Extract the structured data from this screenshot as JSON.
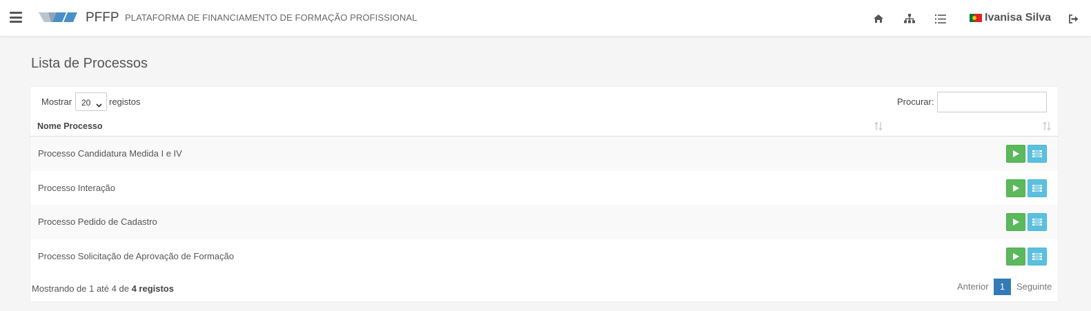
{
  "header": {
    "brand": "PFFP",
    "platform_name": "PLATAFORMA DE FINANCIAMENTO DE FORMAÇÃO PROFISSIONAL",
    "user_name": "Ivanisa Silva",
    "icons": [
      "menu-icon",
      "home-icon",
      "sitemap-icon",
      "list-icon",
      "portugal-flag-icon",
      "logout-icon"
    ],
    "logo_color": "#4a90c8"
  },
  "page": {
    "title": "Lista de Processos"
  },
  "table_controls": {
    "show_label": "Mostrar",
    "page_size": "20",
    "records_label": "registos",
    "search_label": "Procurar:",
    "search_value": ""
  },
  "table": {
    "column_name": "Nome Processo",
    "rows": [
      {
        "name": "Processo Candidatura Medida I e IV"
      },
      {
        "name": "Processo Interação"
      },
      {
        "name": "Processo Pedido de Cadastro"
      },
      {
        "name": "Processo Solicitação de Aprovação de Formação"
      }
    ]
  },
  "footer": {
    "info_prefix": "Mostrando de 1 até 4 de",
    "info_bold": "4 registos",
    "prev_label": "Anterior",
    "current_page": "1",
    "next_label": "Seguinte"
  },
  "colors": {
    "play_button": "#5cb85c",
    "info_button": "#5bc0de",
    "pagination_active": "#337ab7"
  }
}
